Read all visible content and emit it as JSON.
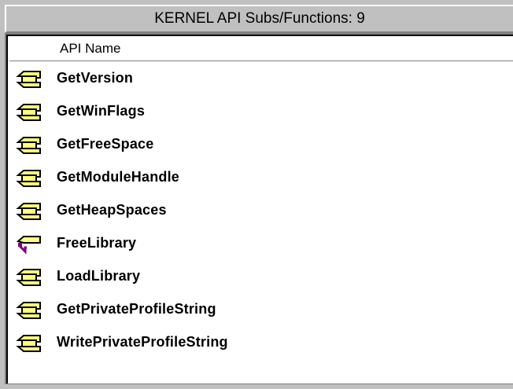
{
  "window": {
    "title": "KERNEL API Subs/Functions: 9"
  },
  "list": {
    "column_header": "API Name",
    "items": [
      {
        "label": "GetVersion",
        "icon": "function-icon"
      },
      {
        "label": "GetWinFlags",
        "icon": "function-icon"
      },
      {
        "label": "GetFreeSpace",
        "icon": "function-icon"
      },
      {
        "label": "GetModuleHandle",
        "icon": "function-icon"
      },
      {
        "label": "GetHeapSpaces",
        "icon": "function-icon"
      },
      {
        "label": "FreeLibrary",
        "icon": "sub-icon"
      },
      {
        "label": "LoadLibrary",
        "icon": "function-icon"
      },
      {
        "label": "GetPrivateProfileString",
        "icon": "function-icon"
      },
      {
        "label": "WritePrivateProfileString",
        "icon": "function-icon"
      }
    ]
  },
  "colors": {
    "face": "#c0c0c0",
    "list_background": "#ffffff",
    "icon_yellow": "#ffff80",
    "icon_outline": "#000000",
    "sub_icon_accent": "#800080"
  }
}
